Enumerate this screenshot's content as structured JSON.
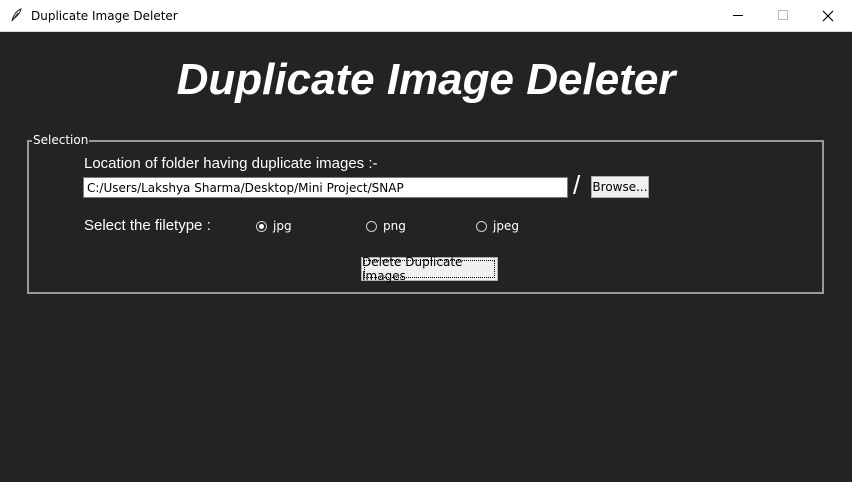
{
  "window": {
    "title": "Duplicate Image Deleter",
    "icon": "feather-icon",
    "controls": {
      "minimize": "minimize-icon",
      "maximize": "maximize-icon",
      "close": "close-icon"
    }
  },
  "heading": "Duplicate Image Deleter",
  "selection": {
    "legend": "Selection",
    "folder_label": "Location of folder having duplicate images :-",
    "folder_path": "C:/Users/Lakshya Sharma/Desktop/Mini Project/SNAP",
    "separator": "/",
    "browse_label": "Browse...",
    "filetype_label": "Select the filetype :",
    "filetypes": [
      {
        "label": "jpg",
        "selected": true
      },
      {
        "label": "png",
        "selected": false
      },
      {
        "label": "jpeg",
        "selected": false
      }
    ],
    "delete_label": "Delete Duplicate Images"
  },
  "colors": {
    "background": "#232323",
    "text": "#ffffff",
    "frame_border": "#9a9a9a",
    "button_bg": "#f0f0f0"
  }
}
